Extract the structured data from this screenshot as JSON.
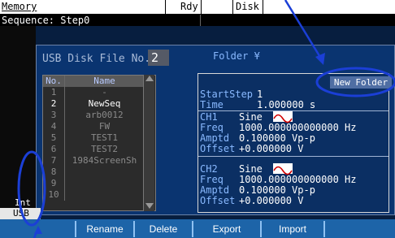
{
  "topbar": {
    "memory": "Memory",
    "rdy": "Rdy",
    "disk": "Disk"
  },
  "sequence": "Sequence: Step0",
  "header": {
    "usb_title": "USB Disk File No.",
    "file_no": "2",
    "folder": "Folder ¥"
  },
  "table": {
    "col_no": "No.",
    "col_name": "Name",
    "rows": [
      {
        "no": "1",
        "name": "-"
      },
      {
        "no": "2",
        "name": "NewSeq"
      },
      {
        "no": "3",
        "name": "arb0012"
      },
      {
        "no": "4",
        "name": "FW"
      },
      {
        "no": "5",
        "name": "TEST1"
      },
      {
        "no": "6",
        "name": "TEST2"
      },
      {
        "no": "7",
        "name": "1984ScreenSh"
      },
      {
        "no": "8",
        "name": ""
      },
      {
        "no": "9",
        "name": ""
      },
      {
        "no": "10",
        "name": ""
      }
    ]
  },
  "new_folder": "New Folder",
  "info": {
    "startstep_label": "StartStep",
    "startstep_val": "1",
    "time_label": "Time",
    "time_val": "1.000000 s",
    "ch1_label": "CH1",
    "ch1_wave": "Sine",
    "ch1_freq_label": "Freq",
    "ch1_freq_val": "1000.000000000000 Hz",
    "ch1_amp_label": "Amptd",
    "ch1_amp_val": "0.100000 Vp-p",
    "ch1_off_label": "Offset",
    "ch1_off_val": "+0.000000 V",
    "ch2_label": "CH2",
    "ch2_wave": "Sine",
    "ch2_freq_label": "Freq",
    "ch2_freq_val": "1000.000000000000 Hz",
    "ch2_amp_label": "Amptd",
    "ch2_amp_val": "0.100000 Vp-p",
    "ch2_off_label": "Offset",
    "ch2_off_val": "+0.000000 V"
  },
  "left": {
    "int_label": "Int",
    "usb_label": "USB"
  },
  "softkeys": {
    "rename": "Rename",
    "delete": "Delete",
    "export": "Export",
    "import": "Import"
  },
  "colors": {
    "annotation": "#1b3fd6",
    "panel": "#0a3470",
    "softkey": "#1d64a8"
  }
}
